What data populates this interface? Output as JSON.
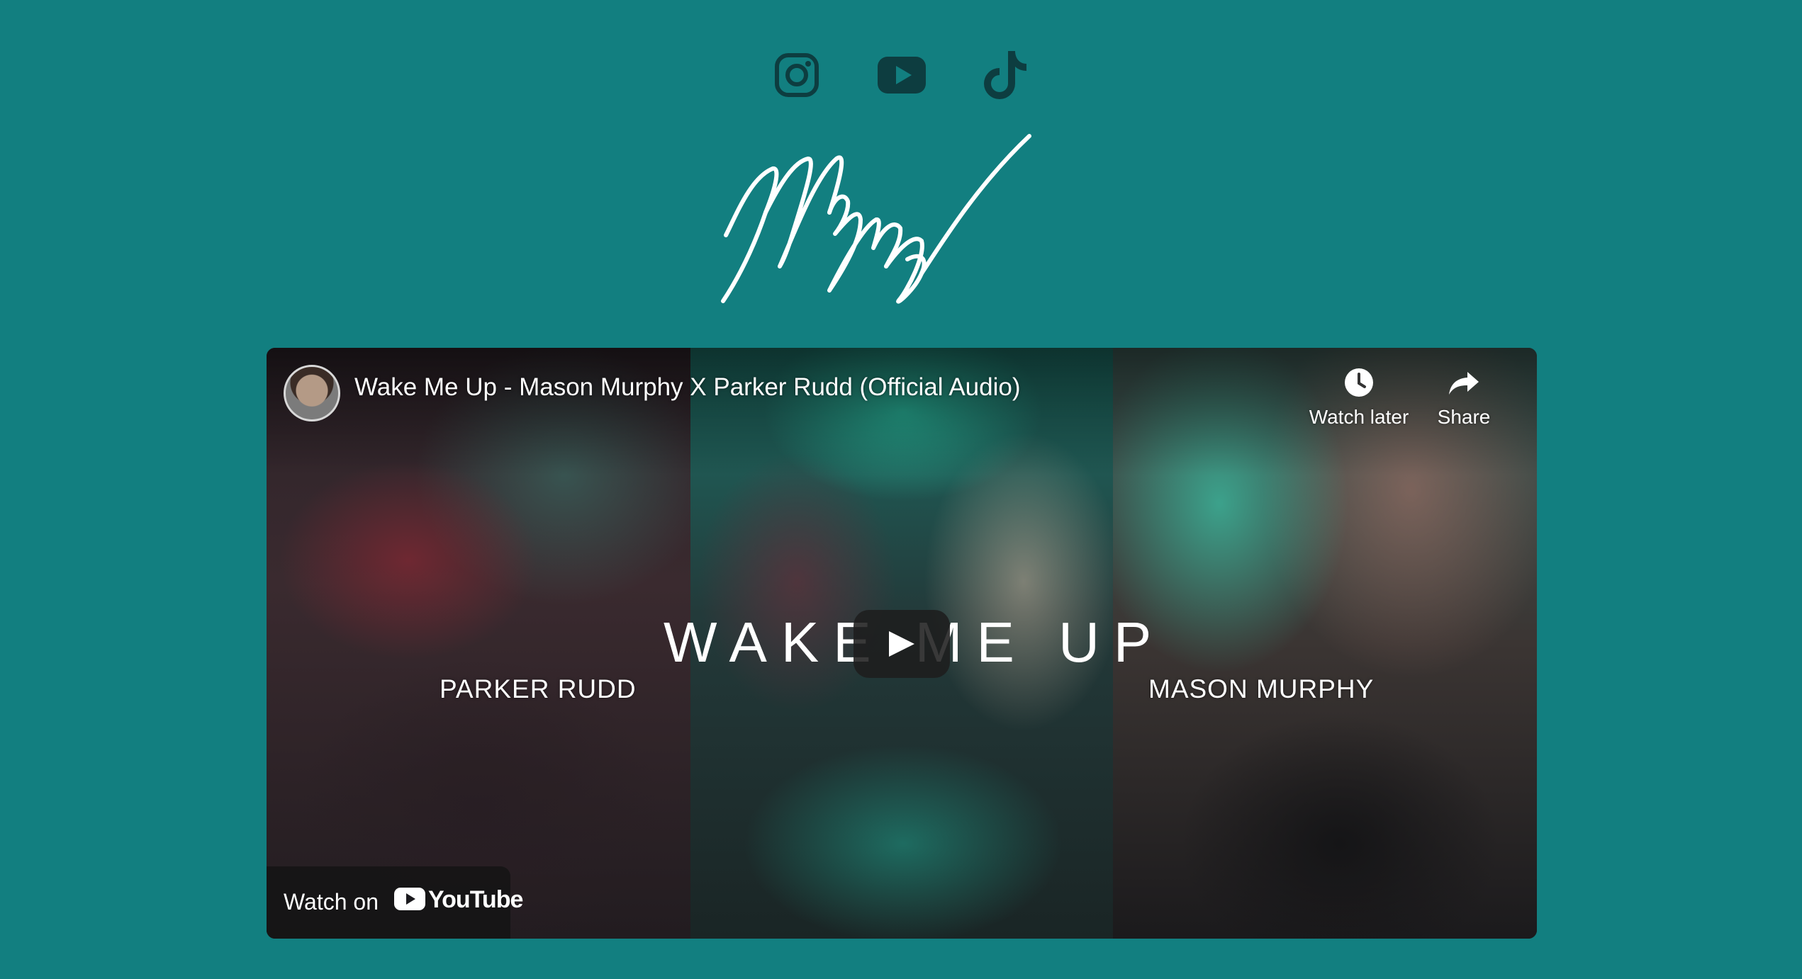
{
  "social": {
    "instagram_icon": "instagram-icon",
    "youtube_icon": "youtube-icon",
    "tiktok_icon": "tiktok-icon",
    "icon_color": "#0d3d40"
  },
  "logo": {
    "signature_text": "MyMurf",
    "color": "#ffffff"
  },
  "video": {
    "title": "Wake Me Up - Mason Murphy X Parker Rudd (Official Audio)",
    "watch_later_label": "Watch later",
    "share_label": "Share",
    "overlay_title": "WAKE ME UP",
    "left_name": "PARKER RUDD",
    "right_name": "MASON MURPHY",
    "watch_on_label": "Watch on",
    "youtube_wordmark": "YouTube"
  },
  "colors": {
    "page_background": "#127f80",
    "youtube_red": "#ff0000"
  }
}
